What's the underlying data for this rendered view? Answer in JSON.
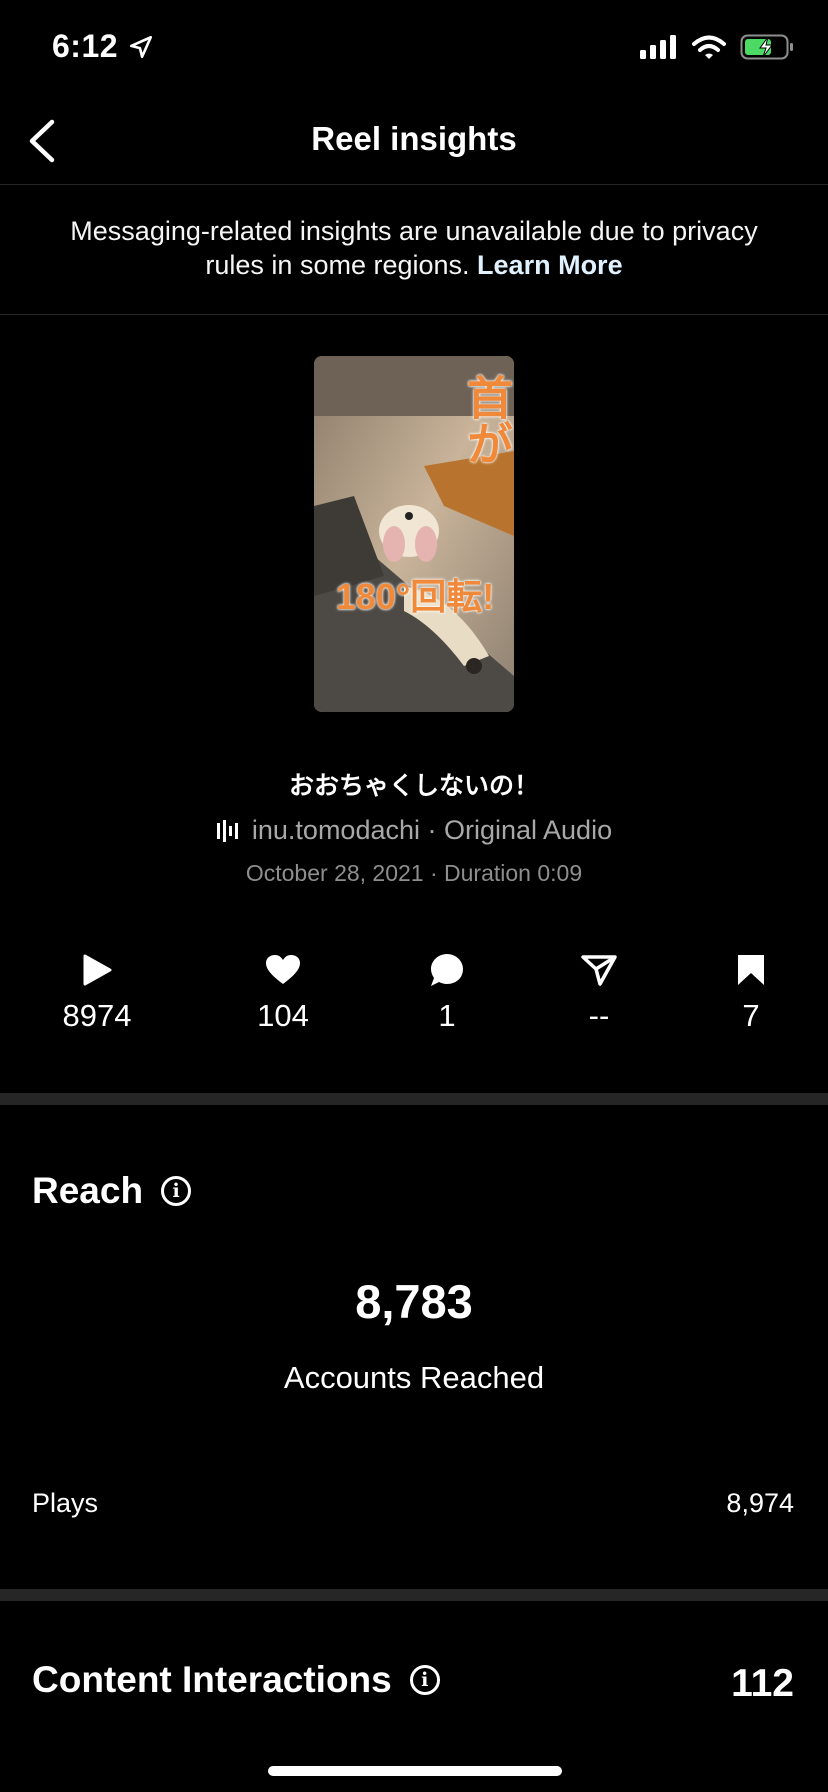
{
  "status": {
    "time": "6:12"
  },
  "header": {
    "title": "Reel insights"
  },
  "notice": {
    "text": "Messaging-related insights are unavailable due to privacy rules in some regions.",
    "link": "Learn More"
  },
  "reel": {
    "overlay_top": "首が",
    "overlay_bottom": "180°回転!",
    "caption": "おおちゃくしないの！",
    "audio": "inu.tomodachi · Original Audio",
    "meta": "October 28, 2021 · Duration 0:09"
  },
  "stats": {
    "plays": "8974",
    "likes": "104",
    "comments": "1",
    "shares": "--",
    "saves": "7"
  },
  "reach": {
    "title": "Reach",
    "value": "8,783",
    "label": "Accounts Reached",
    "plays_label": "Plays",
    "plays_value": "8,974"
  },
  "interactions": {
    "title": "Content Interactions",
    "value": "112"
  },
  "colors": {
    "background": "#000000",
    "divider": "#262626",
    "battery": "#4cd964"
  },
  "icons": [
    "back-chevron-icon",
    "location-arrow-icon",
    "signal-icon",
    "wifi-icon",
    "battery-icon",
    "audio-wave-icon",
    "play-icon",
    "heart-icon",
    "comment-icon",
    "send-icon",
    "bookmark-icon",
    "info-icon"
  ]
}
